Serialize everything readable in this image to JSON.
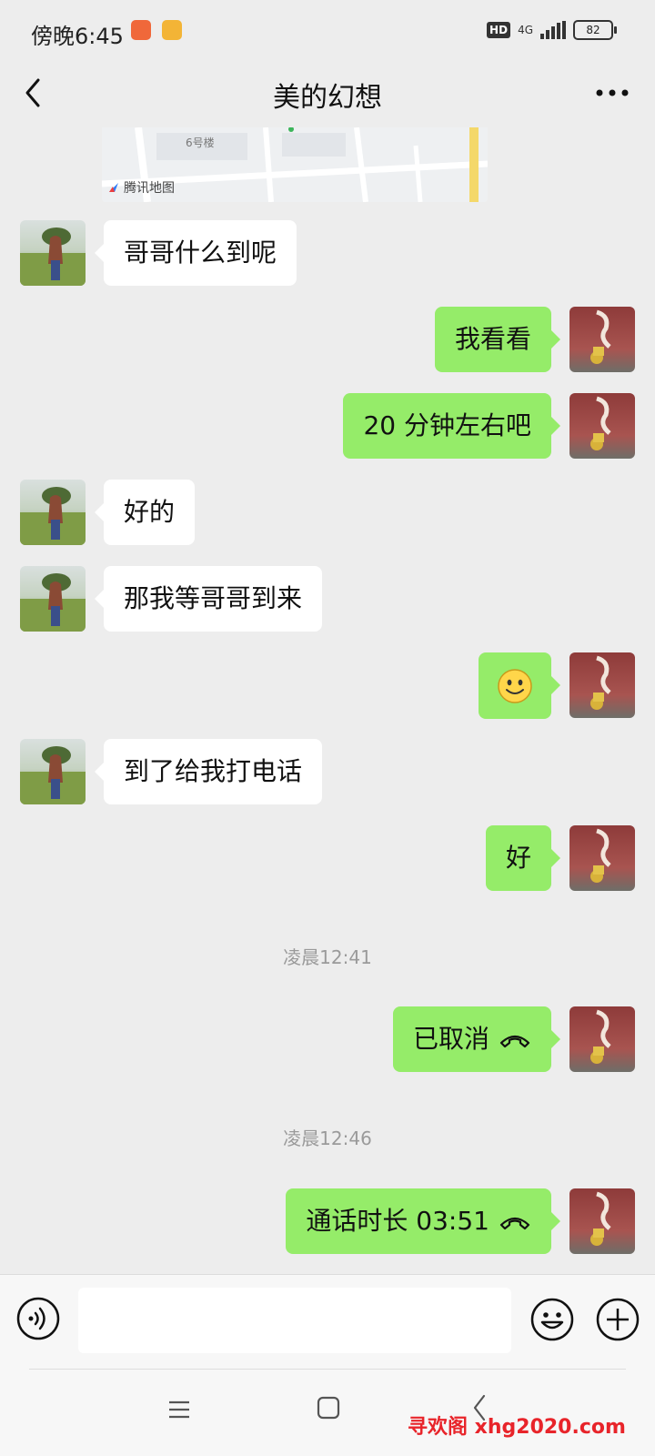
{
  "status_bar": {
    "time": "傍晚6:45",
    "hd": "HD",
    "network": "4G",
    "battery": "82"
  },
  "header": {
    "title": "美的幻想"
  },
  "map": {
    "label": "腾讯地图",
    "building": "6号楼"
  },
  "messages": [
    {
      "side": "in",
      "text": "哥哥什么到呢"
    },
    {
      "side": "out",
      "text": "我看看"
    },
    {
      "side": "out",
      "text": "20 分钟左右吧"
    },
    {
      "side": "in",
      "text": "好的"
    },
    {
      "side": "in",
      "text": "那我等哥哥到来"
    },
    {
      "side": "out",
      "emoji": "smiley"
    },
    {
      "side": "in",
      "text": "到了给我打电话"
    },
    {
      "side": "out",
      "text": "好"
    },
    {
      "timestamp": "凌晨12:41"
    },
    {
      "side": "out",
      "text": "已取消",
      "icon": "phone-hangup-icon"
    },
    {
      "timestamp": "凌晨12:46"
    },
    {
      "side": "out",
      "text": "通话时长 03:51",
      "icon": "phone-hangup-icon"
    }
  ],
  "input_bar": {
    "placeholder": ""
  },
  "watermark": "寻欢阁 xhg2020.com",
  "colors": {
    "background": "#ededed",
    "outgoing_bubble": "#95ec69",
    "incoming_bubble": "#ffffff"
  }
}
